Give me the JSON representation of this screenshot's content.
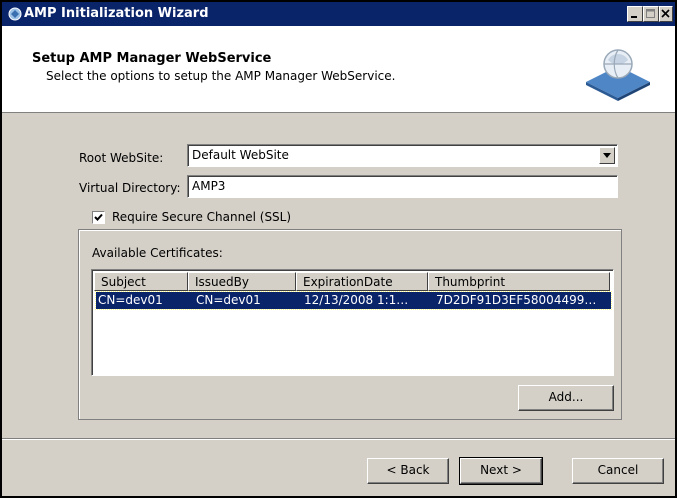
{
  "window": {
    "title": "AMP Initialization Wizard"
  },
  "header": {
    "title": "Setup AMP Manager WebService",
    "subtitle": "Select the options to setup the AMP Manager WebService."
  },
  "form": {
    "root_website_label": "Root WebSite:",
    "root_website_value": "Default WebSite",
    "virtual_directory_label": "Virtual Directory:",
    "virtual_directory_value": "AMP3",
    "ssl_label": "Require Secure Channel (SSL)",
    "ssl_checked": true,
    "certificates_label": "Available Certificates:"
  },
  "certificates": {
    "columns": [
      "Subject",
      "IssuedBy",
      "ExpirationDate",
      "Thumbprint"
    ],
    "rows": [
      [
        "CN=dev01",
        "CN=dev01",
        "12/13/2008 1:1…",
        "7D2DF91D3EF58004499…"
      ]
    ]
  },
  "buttons": {
    "add": "Add...",
    "back": "< Back",
    "next": "Next >",
    "cancel": "Cancel"
  },
  "colors": {
    "titlebar": "#0a246a",
    "dialog": "#d4d0c8",
    "selection": "#0a246a"
  }
}
